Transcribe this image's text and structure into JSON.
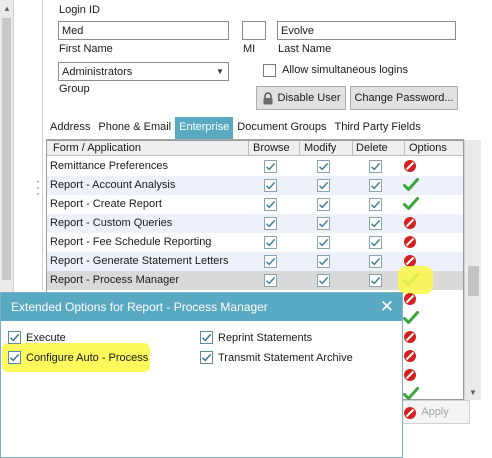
{
  "user": {
    "login_id_label": "Login ID",
    "first_name_value": "Med",
    "first_name_label": "First Name",
    "mi_value": "",
    "mi_label": "MI",
    "last_name_value": "Evolve",
    "last_name_label": "Last Name",
    "group_value": "Administrators",
    "group_label": "Group",
    "allow_simultaneous_label": "Allow simultaneous logins",
    "disable_user_label": "Disable User",
    "change_password_label": "Change Password..."
  },
  "tabs": [
    "Address",
    "Phone & Email",
    "Enterprise",
    "Document Groups",
    "Third Party Fields"
  ],
  "active_tab": "Enterprise",
  "grid": {
    "headers": [
      "Form / Application",
      "Browse",
      "Modify",
      "Delete",
      "Options"
    ],
    "rows": [
      {
        "name": "Remittance Preferences",
        "browse": true,
        "modify": true,
        "delete": true,
        "option": "deny"
      },
      {
        "name": "Report - Account Analysis",
        "browse": true,
        "modify": true,
        "delete": true,
        "option": "check"
      },
      {
        "name": "Report - Create Report",
        "browse": true,
        "modify": true,
        "delete": true,
        "option": "check"
      },
      {
        "name": "Report - Custom Queries",
        "browse": true,
        "modify": true,
        "delete": true,
        "option": "deny"
      },
      {
        "name": "Report - Fee Schedule Reporting",
        "browse": true,
        "modify": true,
        "delete": true,
        "option": "deny"
      },
      {
        "name": "Report - Generate Statement Letters",
        "browse": true,
        "modify": true,
        "delete": true,
        "option": "deny"
      },
      {
        "name": "Report - Process Manager",
        "browse": true,
        "modify": true,
        "delete": true,
        "option": "check"
      }
    ],
    "hidden_options": [
      "deny",
      "check",
      "deny",
      "deny",
      "deny",
      "check",
      "deny"
    ]
  },
  "apply_label": "Apply",
  "popup": {
    "title": "Extended Options for Report - Process Manager",
    "options": [
      {
        "label": "Execute",
        "checked": true
      },
      {
        "label": "Reprint Statements",
        "checked": true
      },
      {
        "label": "Configure Auto - Process",
        "checked": true
      },
      {
        "label": "Transmit Statement Archive",
        "checked": true
      }
    ]
  },
  "colors": {
    "accent": "#5aa9c3",
    "highlight": "#fbf84a",
    "check_green": "#3aa53a",
    "deny_red": "#d42020"
  }
}
